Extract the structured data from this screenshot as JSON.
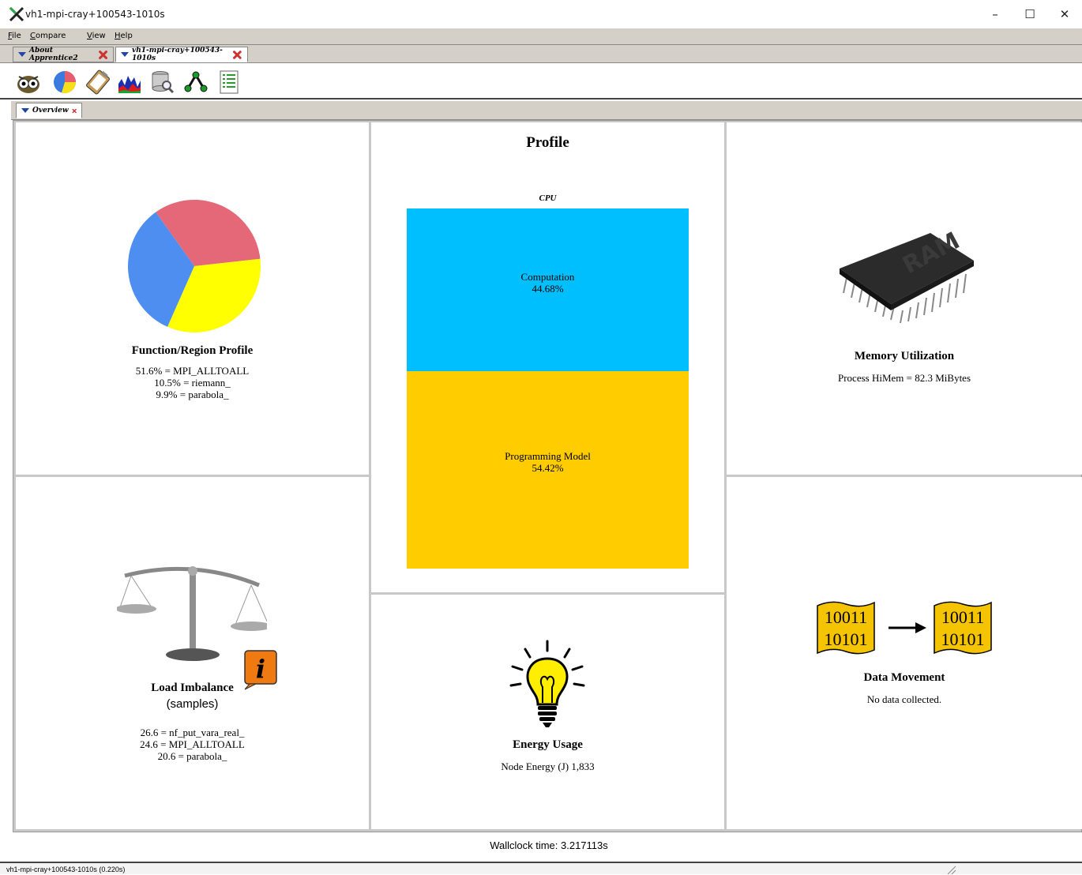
{
  "window": {
    "title": "vh1-mpi-cray+100543-1010s"
  },
  "menubar": {
    "file": "File",
    "compare": "Compare",
    "view": "View",
    "help": "Help"
  },
  "tabs": [
    {
      "label": "About Apprentice2"
    },
    {
      "label": "vh1-mpi-cray+100543-1010s"
    }
  ],
  "toolbar": {
    "icons": [
      "overview-owl-icon",
      "pie-chart-icon",
      "clipboard-icon",
      "bar-histogram-icon",
      "search-database-icon",
      "call-tree-icon",
      "text-report-icon"
    ]
  },
  "subtabs": [
    {
      "label": "Overview"
    }
  ],
  "profile_panel": {
    "title": "Function/Region Profile",
    "lines": [
      "51.6% = MPI_ALLTOALL",
      "10.5% = riemann_",
      "9.9% = parabola_"
    ],
    "slices": [
      {
        "label": "red",
        "fraction": 0.331,
        "color": "#e56878"
      },
      {
        "label": "yellow",
        "fraction": 0.334,
        "color": "#ffff00"
      },
      {
        "label": "blue",
        "fraction": 0.335,
        "color": "#4d8ef0"
      }
    ]
  },
  "cpu_panel": {
    "title": "Profile",
    "subtitle": "CPU",
    "segments": [
      {
        "label": "Computation",
        "value": "44.68%",
        "pct": 44.68,
        "color": "#00bfff"
      },
      {
        "label": "Programming Model",
        "value": "54.42%",
        "pct": 54.42,
        "color": "#ffcc00"
      }
    ]
  },
  "memory_panel": {
    "title": "Memory Utilization",
    "line": "Process HiMem = 82.3 MiBytes",
    "chip_label": "RAM"
  },
  "imbalance_panel": {
    "title": "Load Imbalance",
    "subtitle": "(samples)",
    "lines": [
      "26.6 = nf_put_vara_real_",
      "24.6 = MPI_ALLTOALL",
      "20.6 = parabola_"
    ],
    "info_glyph": "i"
  },
  "energy_panel": {
    "title": "Energy Usage",
    "line": "Node Energy (J)  1,833"
  },
  "data_panel": {
    "title": "Data Movement",
    "line": "No data collected.",
    "bits_a": "10011",
    "bits_b": "10101"
  },
  "wallclock": "Wallclock time: 3.217113s",
  "status": "vh1-mpi-cray+100543-1010s (0.220s)",
  "colors": {
    "accent_blue": "#2244aa",
    "close_red": "#cc3333",
    "chrome": "#d4d0c8"
  }
}
